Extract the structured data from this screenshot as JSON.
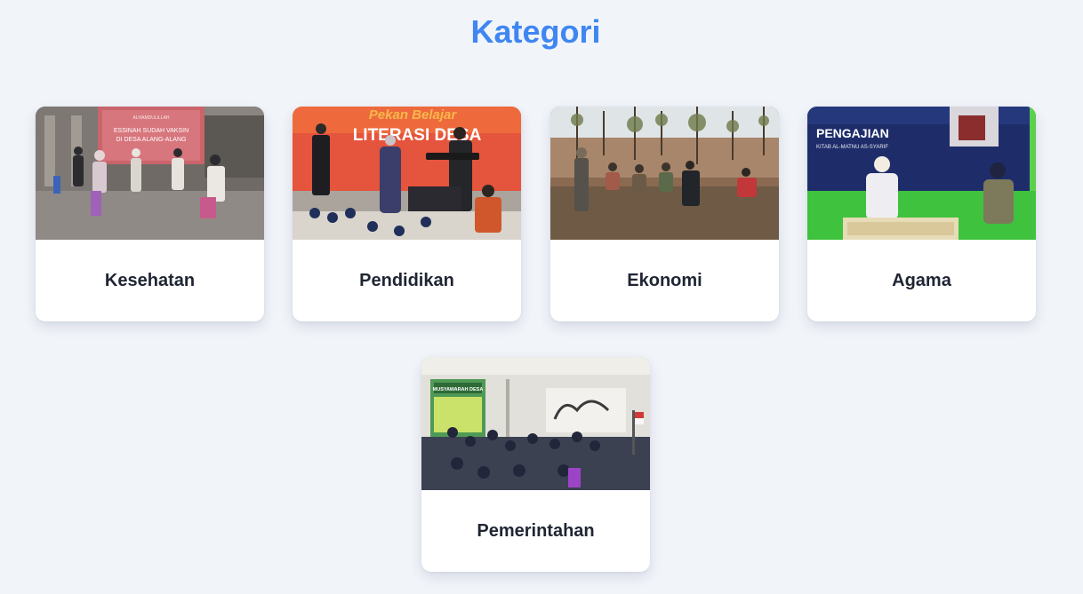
{
  "page": {
    "title": "Kategori"
  },
  "categories": [
    {
      "label": "Kesehatan",
      "image": "health-vaccination-event-photo",
      "banner_lines": [
        "ALHAMDULILLAH",
        "ESSINAH SUDAH VAKSIN",
        "DI DESA ALANG-ALANG"
      ]
    },
    {
      "label": "Pendidikan",
      "image": "education-literacy-week-photo",
      "banner_lines": [
        "Pekan Belajar",
        "LITERASI DESA"
      ]
    },
    {
      "label": "Ekonomi",
      "image": "economy-farmers-field-photo",
      "banner_lines": []
    },
    {
      "label": "Agama",
      "image": "religion-study-gathering-photo",
      "banner_lines": [
        "PENGAJIAN",
        "KITAB AL-MATNU AS-SYARIF"
      ]
    },
    {
      "label": "Pemerintahan",
      "image": "government-village-meeting-photo",
      "banner_lines": [
        "MUSYAWARAH DESA"
      ]
    }
  ],
  "colors": {
    "background": "#f1f4f9",
    "title": "#3f86f2",
    "card": "#ffffff",
    "label": "#1f2533"
  }
}
